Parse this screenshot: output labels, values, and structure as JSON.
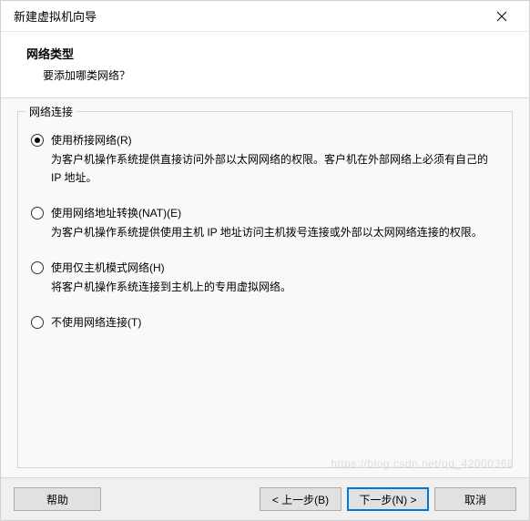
{
  "titlebar": {
    "title": "新建虚拟机向导"
  },
  "header": {
    "title": "网络类型",
    "subtitle": "要添加哪类网络？"
  },
  "group": {
    "label": "网络连接",
    "options": [
      {
        "label": "使用桥接网络(R)",
        "desc": "为客户机操作系统提供直接访问外部以太网网络的权限。客户机在外部网络上必须有自己的 IP 地址。",
        "checked": true
      },
      {
        "label": "使用网络地址转换(NAT)(E)",
        "desc": "为客户机操作系统提供使用主机 IP 地址访问主机拨号连接或外部以太网网络连接的权限。",
        "checked": false
      },
      {
        "label": "使用仅主机模式网络(H)",
        "desc": "将客户机操作系统连接到主机上的专用虚拟网络。",
        "checked": false
      },
      {
        "label": "不使用网络连接(T)",
        "desc": "",
        "checked": false
      }
    ]
  },
  "footer": {
    "help": "帮助",
    "back": "< 上一步(B)",
    "next": "下一步(N) >",
    "cancel": "取消"
  },
  "watermark": "https://blog.csdn.net/qq_42000368"
}
